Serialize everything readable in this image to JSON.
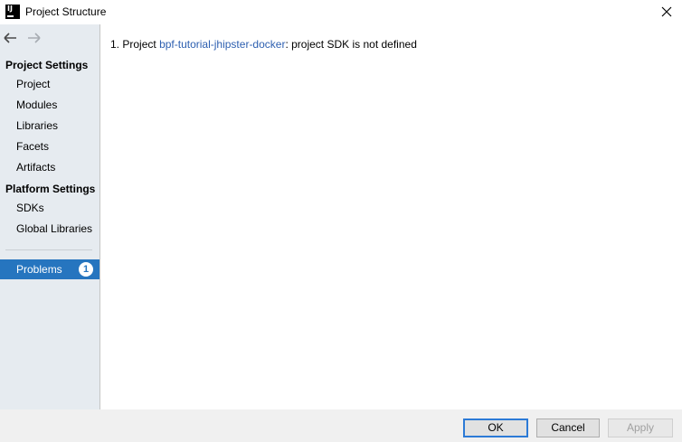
{
  "window": {
    "title": "Project Structure"
  },
  "sidebar": {
    "project_settings_title": "Project Settings",
    "project_settings_items": [
      "Project",
      "Modules",
      "Libraries",
      "Facets",
      "Artifacts"
    ],
    "platform_settings_title": "Platform Settings",
    "platform_settings_items": [
      "SDKs",
      "Global Libraries"
    ],
    "problems": {
      "label": "Problems",
      "count": "1"
    }
  },
  "content": {
    "problem": {
      "index": "1.",
      "prefix": "Project",
      "link": "bpf-tutorial-jhipster-docker",
      "suffix": ": project SDK is not defined"
    }
  },
  "footer": {
    "ok": "OK",
    "cancel": "Cancel",
    "apply": "Apply"
  },
  "colors": {
    "selection": "#2675bf",
    "link": "#2d5fb0",
    "sidebar_bg": "#e6ebf0"
  }
}
